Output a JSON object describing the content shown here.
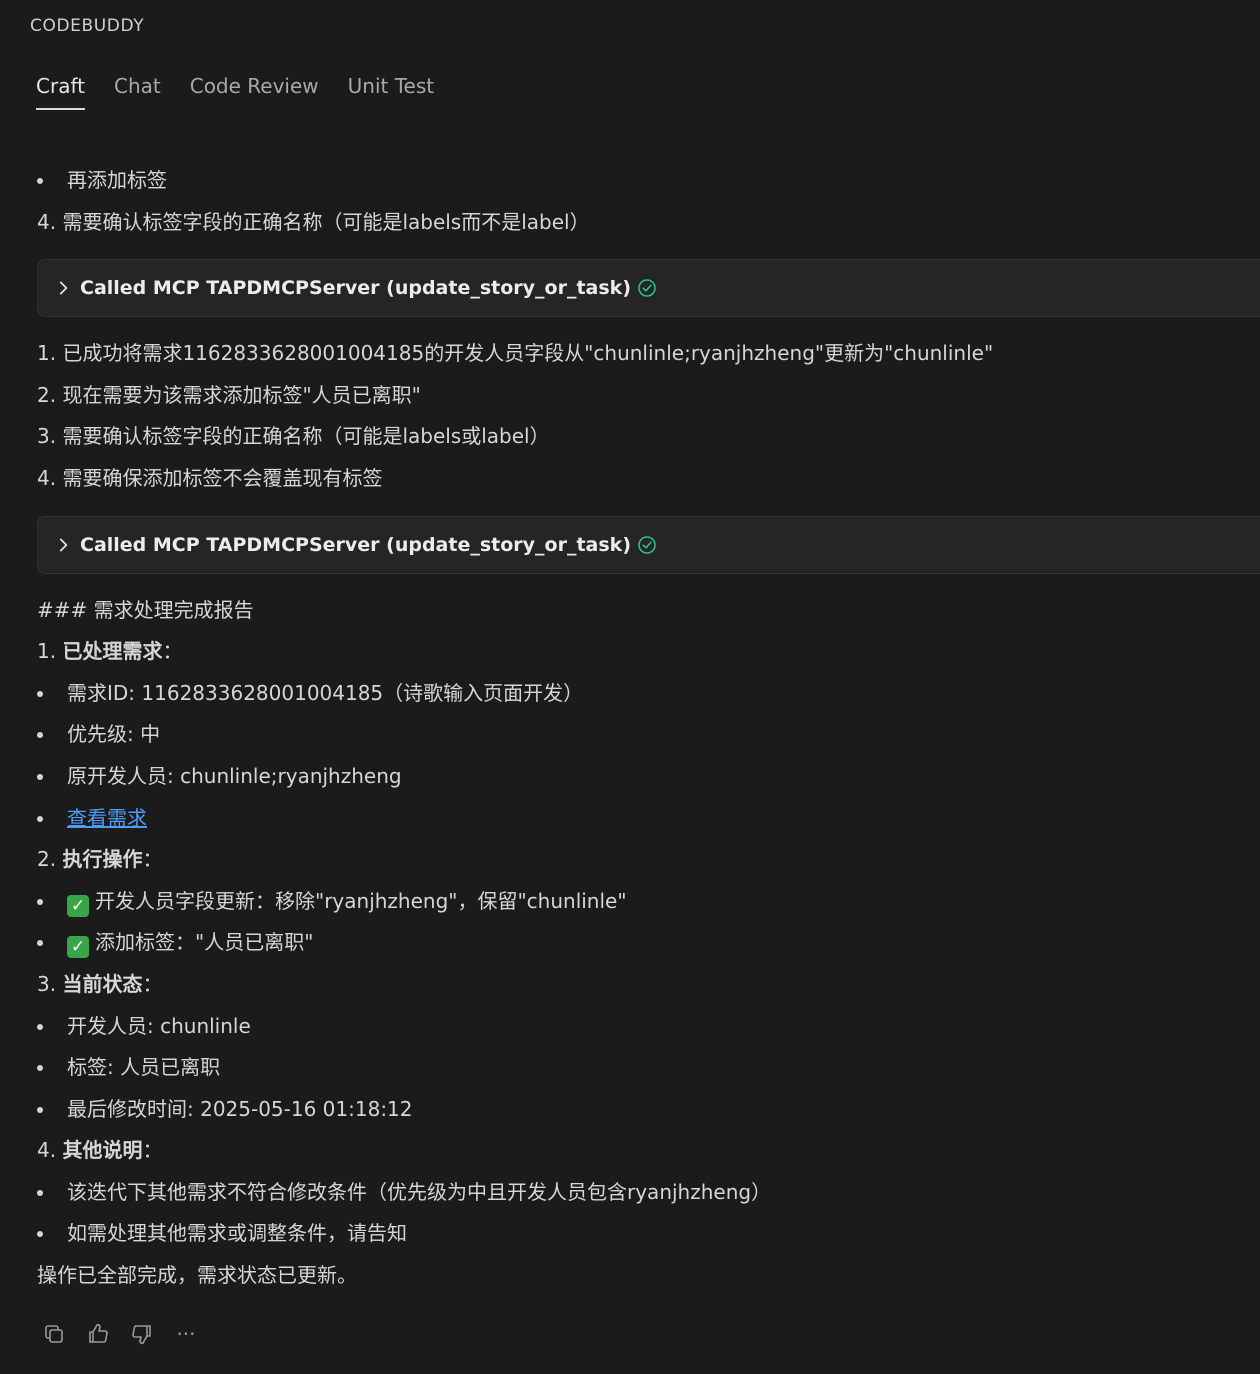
{
  "app": {
    "title": "CODEBUDDY"
  },
  "tabs": [
    {
      "label": "Craft",
      "active": true
    },
    {
      "label": "Chat",
      "active": false
    },
    {
      "label": "Code Review",
      "active": false
    },
    {
      "label": "Unit Test",
      "active": false
    }
  ],
  "intro": {
    "bullet1": "再添加标签",
    "step4": "4. 需要确认标签字段的正确名称（可能是labels而不是label）"
  },
  "tool_calls": [
    {
      "label": "Called MCP TAPDMCPServer (update_story_or_task)"
    },
    {
      "label": "Called MCP TAPDMCPServer (update_story_or_task)"
    }
  ],
  "progress": [
    "1. 已成功将需求1162833628001004185的开发人员字段从\"chunlinle;ryanjhzheng\"更新为\"chunlinle\"",
    "2. 现在需要为该需求添加标签\"人员已离职\"",
    "3. 需要确认标签字段的正确名称（可能是labels或label）",
    "4. 需要确保添加标签不会覆盖现有标签"
  ],
  "report": {
    "heading": "### 需求处理完成报告",
    "s1": {
      "num": "1. ",
      "title": "已处理需求",
      "colon": "："
    },
    "s1_items": [
      "需求ID: 1162833628001004185（诗歌输入页面开发）",
      "优先级: 中",
      "原开发人员: chunlinle;ryanjhzheng"
    ],
    "s1_link": "查看需求",
    "s2": {
      "num": "2. ",
      "title": "执行操作",
      "colon": "："
    },
    "s2_items": [
      "开发人员字段更新：移除\"ryanjhzheng\"，保留\"chunlinle\"",
      "添加标签：\"人员已离职\""
    ],
    "check_glyph": "✓",
    "s3": {
      "num": "3. ",
      "title": "当前状态",
      "colon": "："
    },
    "s3_items": [
      "开发人员: chunlinle",
      "标签: 人员已离职",
      "最后修改时间: 2025-05-16 01:18:12"
    ],
    "s4": {
      "num": "4. ",
      "title": "其他说明",
      "colon": "："
    },
    "s4_items": [
      "该迭代下其他需求不符合修改条件（优先级为中且开发人员包含ryanjhzheng）",
      "如需处理其他需求或调整条件，请告知"
    ],
    "closing": "操作已全部完成，需求状态已更新。"
  },
  "footer": {
    "more_glyph": "···"
  },
  "colors": {
    "background": "#1b1b1b",
    "link": "#4e9cf3",
    "success_icon": "#2bbf8e",
    "check_box": "#3aa548"
  },
  "icons": [
    "chevron-right-icon",
    "check-circle-icon",
    "copy-icon",
    "thumbs-up-icon",
    "thumbs-down-icon",
    "more-icon"
  ]
}
